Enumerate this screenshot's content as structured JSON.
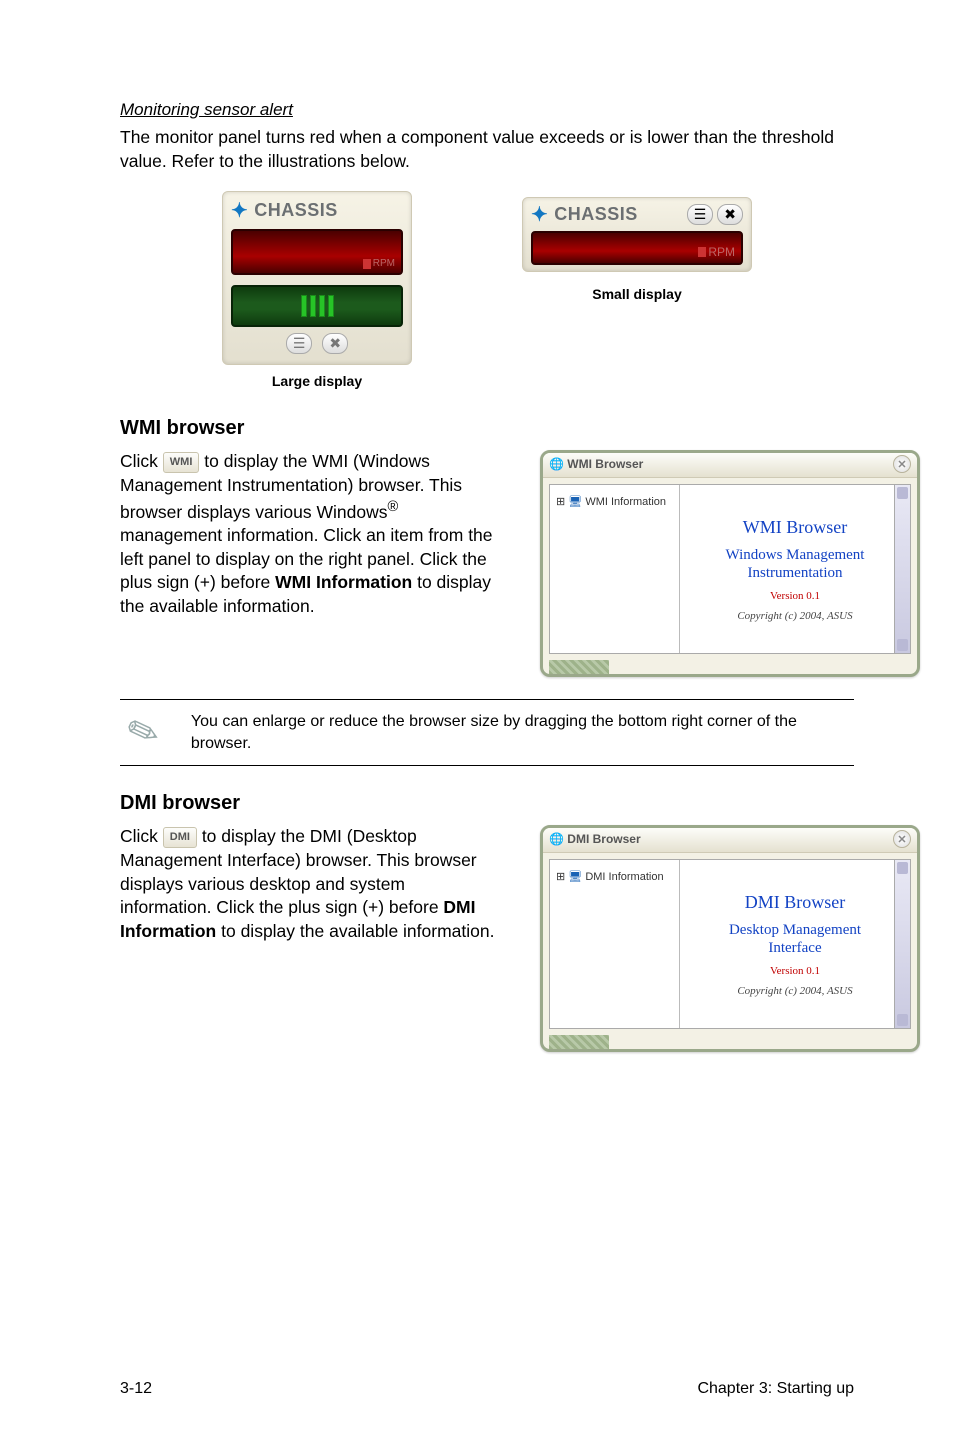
{
  "monitoring": {
    "heading": "Monitoring sensor alert",
    "body": "The monitor panel turns red when a component value exceeds or is lower than the threshold value. Refer to the illustrations below.",
    "chassis_label": "CHASSIS",
    "rpm_label": "RPM",
    "large_caption": "Large display",
    "small_caption": "Small display"
  },
  "wmi": {
    "heading": "WMI browser",
    "btn": "WMI",
    "p1a": "Click ",
    "p1b": " to display the WMI (Windows Management Instrumentation) browser. This browser displays various Windows",
    "p1c": " management information. Click an item from the left panel to display on the right panel. Click the plus sign (+) before ",
    "bold": "WMI Information",
    "p1d": " to display the available information.",
    "win_title": "WMI Browser",
    "tree_item": "WMI Information",
    "title_blue": "WMI Browser",
    "sub1": "Windows Management",
    "sub2": "Instrumentation",
    "version": "Version 0.1",
    "copyright": "Copyright (c) 2004, ASUS"
  },
  "note": {
    "text": "You can enlarge or reduce the browser size by dragging the bottom right corner of the browser."
  },
  "dmi": {
    "heading": "DMI browser",
    "btn": "DMI",
    "p1a": "Click ",
    "p1b": " to display the DMI (Desktop Management Interface) browser. This browser displays various desktop and system information. Click the plus sign (+) before ",
    "bold": "DMI Information",
    "p1d": " to display the available information.",
    "win_title": "DMI Browser",
    "tree_item": "DMI Information",
    "title_blue": "DMI Browser",
    "sub1": "Desktop Management",
    "sub2": "Interface",
    "version": "Version 0.1",
    "copyright": "Copyright (c) 2004, ASUS"
  },
  "footer": {
    "left": "3-12",
    "right": "Chapter 3: Starting up"
  },
  "reg_mark": "®"
}
